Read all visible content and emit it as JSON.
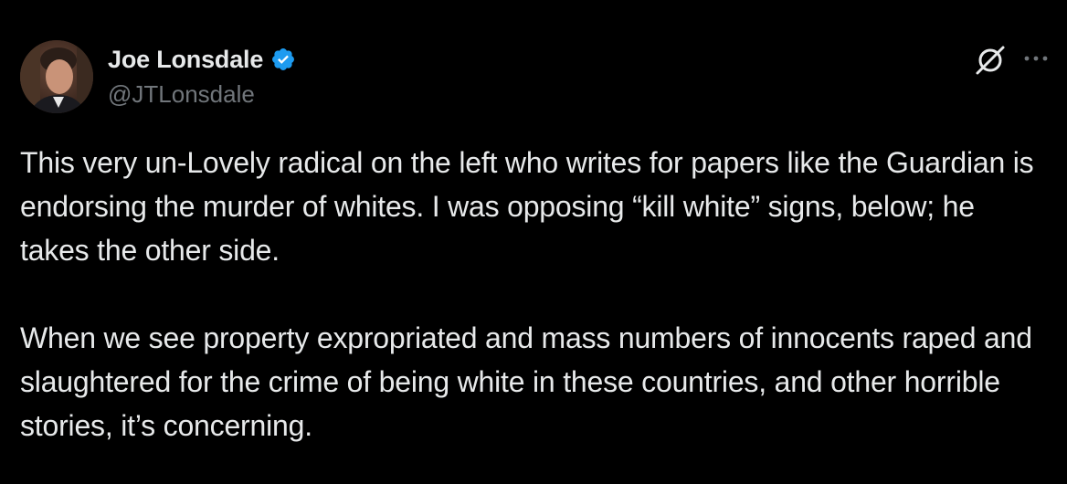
{
  "author": {
    "display_name": "Joe Lonsdale",
    "handle": "@JTLonsdale",
    "verified": true
  },
  "icons": {
    "verified": "verified-badge-icon",
    "grok": "grok-icon",
    "more": "more-options-icon"
  },
  "colors": {
    "background": "#000000",
    "text": "#e7e9ea",
    "secondary_text": "#71767b",
    "verified_badge": "#1d9bf0"
  },
  "tweet": {
    "paragraphs": [
      "This very un-Lovely radical on the left who writes for papers like the Guardian is endorsing the murder of whites. I was opposing “kill white” signs, below; he takes the other side.",
      "When we see property expropriated and mass numbers of innocents raped and slaughtered for the crime of being white in these countries, and other horrible stories, it’s concerning."
    ]
  }
}
